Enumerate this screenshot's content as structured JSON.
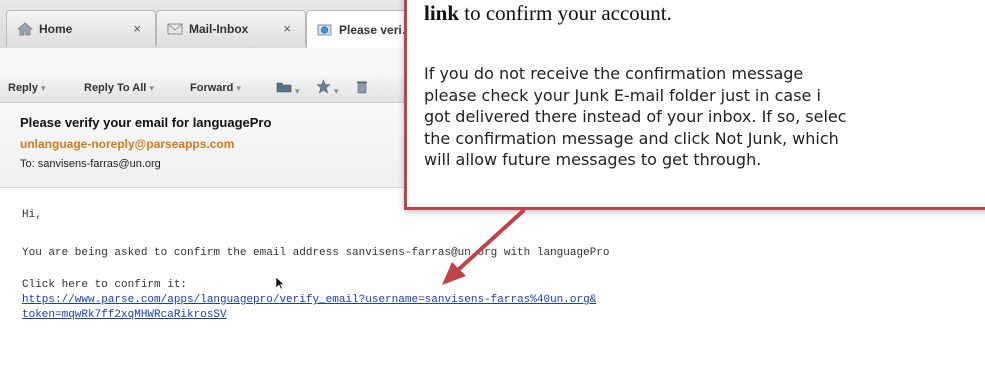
{
  "tabs": [
    {
      "label": "Home",
      "icon": "home-icon",
      "close": "×"
    },
    {
      "label": "Mail-Inbox",
      "icon": "mail-icon",
      "close": "×"
    },
    {
      "label": "Please veri…",
      "icon": "envelope-globe-icon",
      "close": "×"
    }
  ],
  "toolbar": {
    "reply": "Reply",
    "reply_all": "Reply To All",
    "forward": "Forward",
    "caret": "▾"
  },
  "message": {
    "subject": "Please verify your email for languagePro",
    "sender": "unlanguage-noreply@parseapps.com",
    "to": "To:  sanvisens-farras@un.org",
    "greeting": "Hi,",
    "line1": "You are being asked to confirm the email address sanvisens-farras@un.org with languagePro",
    "line2": "Click here to confirm it:",
    "link_line1": "https://www.parse.com/apps/languagepro/verify_email?username=sanvisens-farras%40un.org&",
    "link_line2": "token=mqwRk7ff2xqMHWRcaRikrosSV"
  },
  "callout": {
    "head_bold": "link",
    "head_rest": " to confirm your account.",
    "lines": [
      "If you do not receive the confirmation message",
      "please check your Junk E-mail folder just in case i",
      "got delivered there instead of your inbox. If so, selec",
      "the confirmation message and click Not Junk, which",
      "will allow future messages to get through."
    ]
  },
  "colors": {
    "callout_border": "#c0434a",
    "arrow": "#c0434a",
    "sender": "#d07a1c",
    "link": "#1a3ec2"
  }
}
